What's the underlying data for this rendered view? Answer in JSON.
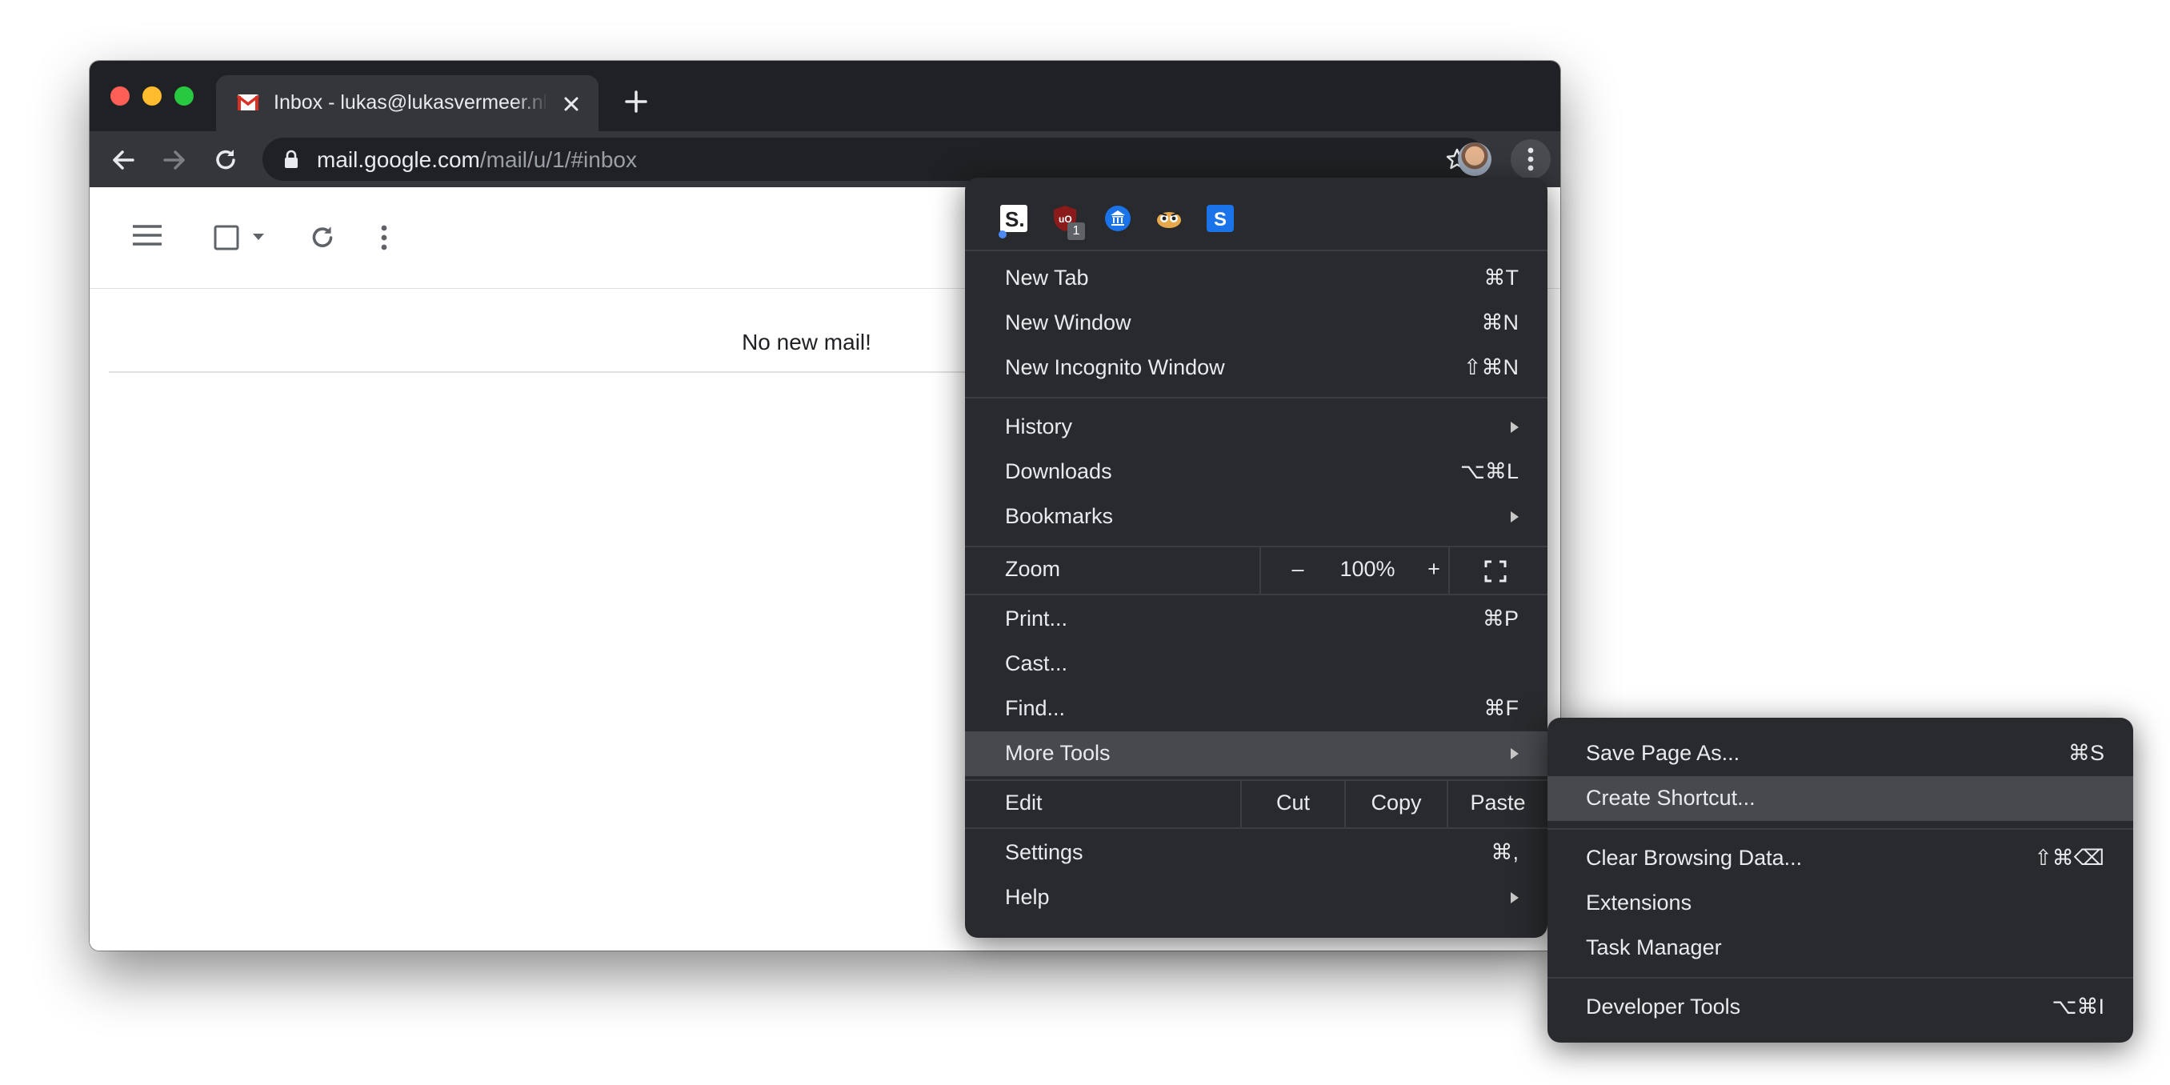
{
  "browser": {
    "tab": {
      "title": "Inbox - lukas@lukasvermeer.nl"
    },
    "address_bar": {
      "host": "mail.google.com",
      "path": "/mail/u/1/#inbox"
    }
  },
  "gmail": {
    "empty_message": "No new mail!"
  },
  "menu": {
    "extensions": [
      "S.",
      "uO",
      "museum",
      "owl",
      "S"
    ],
    "extension_badge": "1",
    "new_tab": {
      "label": "New Tab",
      "shortcut": "⌘T"
    },
    "new_window": {
      "label": "New Window",
      "shortcut": "⌘N"
    },
    "new_incognito": {
      "label": "New Incognito Window",
      "shortcut": "⇧⌘N"
    },
    "history": {
      "label": "History"
    },
    "downloads": {
      "label": "Downloads",
      "shortcut": "⌥⌘L"
    },
    "bookmarks": {
      "label": "Bookmarks"
    },
    "zoom": {
      "label": "Zoom",
      "minus": "–",
      "value": "100%",
      "plus": "+"
    },
    "print": {
      "label": "Print...",
      "shortcut": "⌘P"
    },
    "cast": {
      "label": "Cast..."
    },
    "find": {
      "label": "Find...",
      "shortcut": "⌘F"
    },
    "more_tools": {
      "label": "More Tools"
    },
    "edit": {
      "label": "Edit",
      "cut": "Cut",
      "copy": "Copy",
      "paste": "Paste"
    },
    "settings": {
      "label": "Settings",
      "shortcut": "⌘,"
    },
    "help": {
      "label": "Help"
    }
  },
  "submenu": {
    "save_page": {
      "label": "Save Page As...",
      "shortcut": "⌘S"
    },
    "create_shortcut": {
      "label": "Create Shortcut..."
    },
    "clear_data": {
      "label": "Clear Browsing Data...",
      "shortcut": "⇧⌘⌫"
    },
    "extensions": {
      "label": "Extensions"
    },
    "task_manager": {
      "label": "Task Manager"
    },
    "developer_tools": {
      "label": "Developer Tools",
      "shortcut": "⌥⌘I"
    }
  },
  "colors": {
    "menu_bg": "#292a2d",
    "menu_highlight": "#48494d",
    "titlebar": "#202124",
    "toolbar": "#35363a",
    "gmail_red": "#d93025"
  }
}
